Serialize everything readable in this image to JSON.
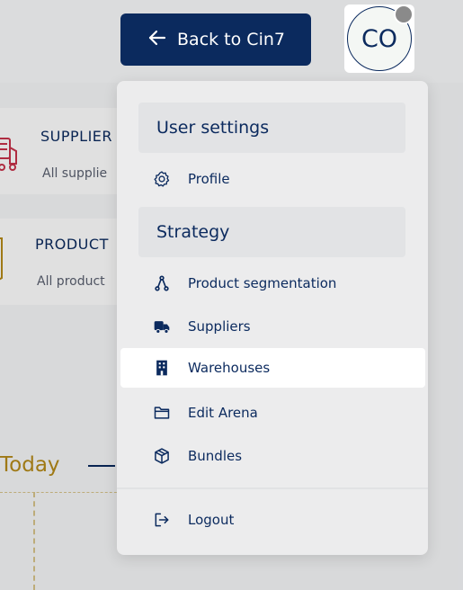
{
  "header": {
    "back_button_label": "Back to Cin7",
    "avatar_initials": "CO"
  },
  "background": {
    "cards": [
      {
        "title": "SUPPLIER",
        "subtitle": "All supplie"
      },
      {
        "title": "PRODUCT",
        "subtitle": "All product"
      }
    ],
    "today_label": "Today"
  },
  "menu": {
    "user_settings_heading": "User settings",
    "profile_label": "Profile",
    "strategy_heading": "Strategy",
    "items": [
      {
        "label": "Product segmentation",
        "icon": "segmentation-icon"
      },
      {
        "label": "Suppliers",
        "icon": "truck-icon"
      },
      {
        "label": "Warehouses",
        "icon": "building-icon",
        "active": true
      },
      {
        "label": "Edit Arena",
        "icon": "folder-icon"
      },
      {
        "label": "Bundles",
        "icon": "package-icon"
      }
    ],
    "logout_label": "Logout"
  },
  "colors": {
    "primary": "#0b2a5e",
    "accent_gold": "#b58a18",
    "truck_red": "#c8334a"
  }
}
